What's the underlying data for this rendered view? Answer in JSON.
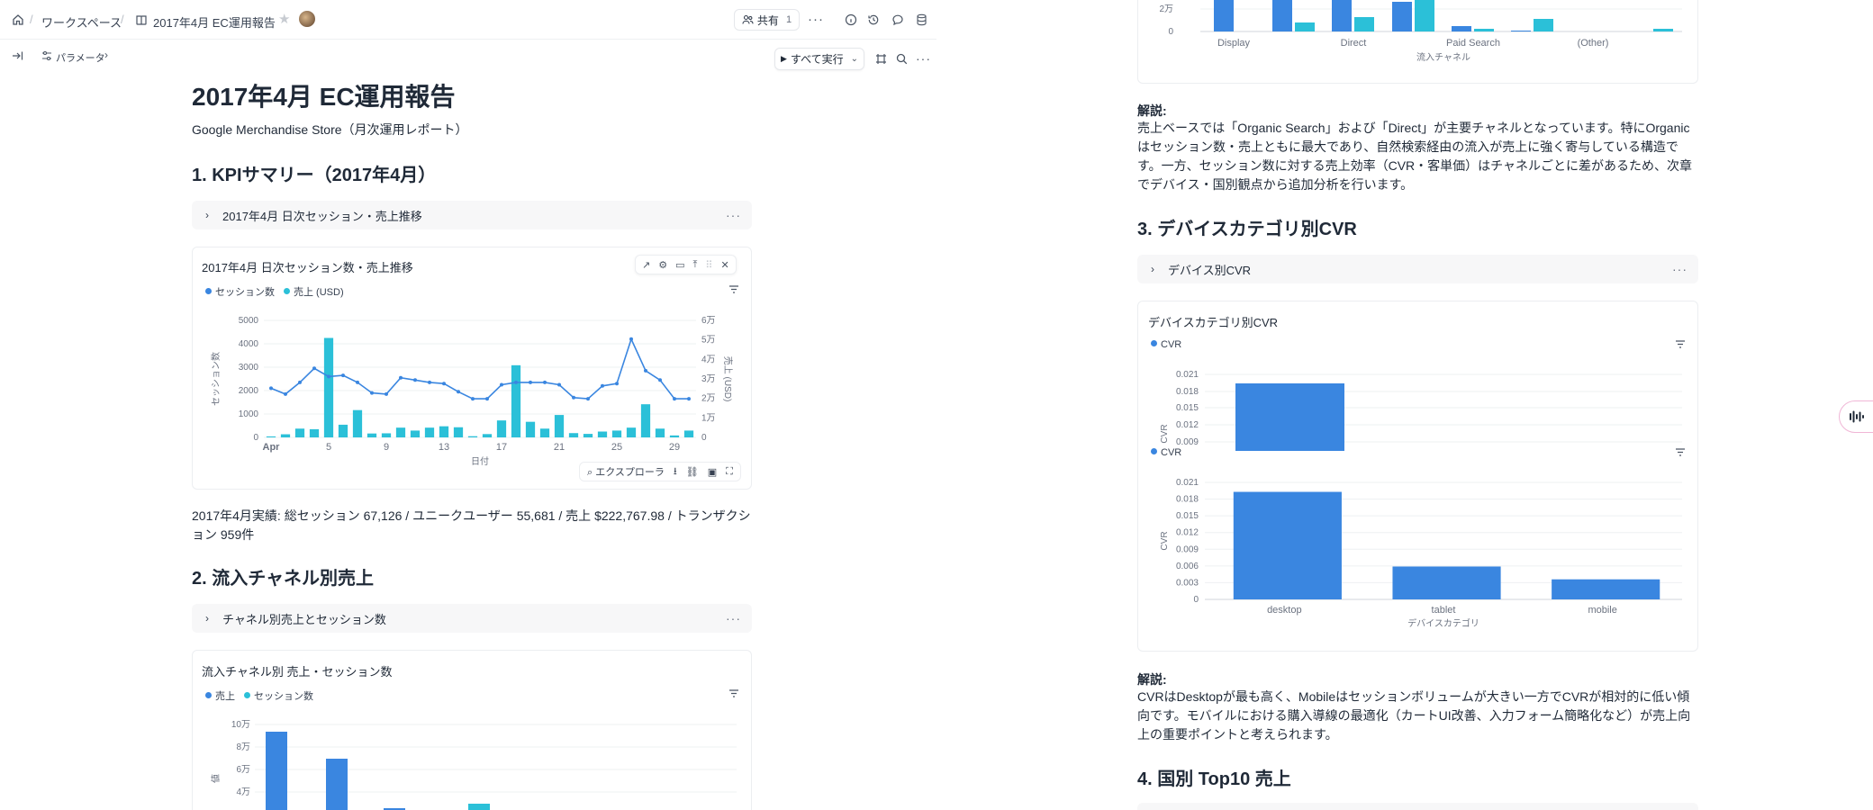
{
  "breadcrumb": {
    "home_icon": "home-icon",
    "workspace": "ワークスペース",
    "notebook": "2017年4月 EC運用報告"
  },
  "header": {
    "share_label": "共有",
    "share_count": "1"
  },
  "subbar": {
    "params_label": "パラメータ",
    "run_all_label": "すべて実行"
  },
  "doc": {
    "title": "2017年4月 EC運用報告",
    "subtitle": "Google Merchandise Store（月次運用レポート）",
    "sec1_heading": "1. KPIサマリー（2017年4月）",
    "sec1_cell_title": "2017年4月 日次セッション・売上推移",
    "sec1_summary": "2017年4月実績: 総セッション 67,126 / ユニークユーザー 55,681 / 売上 $222,767.98 / トランザクション 959件",
    "sec2_heading": "2. 流入チャネル別売上",
    "sec2_cell_title": "チャネル別売上とセッション数",
    "sec2_note_label": "解説:",
    "sec2_note": "売上ベースでは「Organic Search」および「Direct」が主要チャネルとなっています。特にOrganicはセッション数・売上ともに最大であり、自然検索経由の流入が売上に強く寄与している構造です。一方、セッション数に対する売上効率（CVR・客単価）はチャネルごとに差があるため、次章でデバイス・国別観点から追加分析を行います。",
    "sec3_heading": "3. デバイスカテゴリ別CVR",
    "sec3_cell_title": "デバイス別CVR",
    "sec3_note_label": "解説:",
    "sec3_note": "CVRはDesktopが最も高く、Mobileはセッションボリュームが大きい一方でCVRが相対的に低い傾向です。モバイルにおける購入導線の最適化（カートUI改善、入力フォーム簡略化など）が売上向上の重要ポイントと考えられます。",
    "sec4_heading": "4. 国別 Top10 売上"
  },
  "explorer_label": "エクスプローラ",
  "colors": {
    "session": "#3a86e0",
    "sales": "#2bc0d8"
  },
  "chart_data": [
    {
      "type": "bar+line",
      "title": "2017年4月 日次セッション数・売上推移",
      "legend": [
        "セッション数",
        "売上 (USD)"
      ],
      "xlabel": "日付",
      "ylabel": "セッション数",
      "y2label": "売上 (USD)",
      "x_ticks": [
        "Apr",
        "5",
        "9",
        "13",
        "17",
        "21",
        "25",
        "29"
      ],
      "y_ticks": [
        "0",
        "1000",
        "2000",
        "3000",
        "4000",
        "5000"
      ],
      "y2_ticks": [
        "0",
        "1万",
        "2万",
        "3万",
        "4万",
        "5万",
        "6万"
      ],
      "ylim": [
        0,
        5000
      ],
      "y2lim": [
        0,
        60000
      ],
      "days": [
        1,
        2,
        3,
        4,
        5,
        6,
        7,
        8,
        9,
        10,
        11,
        12,
        13,
        14,
        15,
        16,
        17,
        18,
        19,
        20,
        21,
        22,
        23,
        24,
        25,
        26,
        27,
        28,
        29,
        30
      ],
      "sessions": [
        2100,
        1850,
        2350,
        2950,
        2600,
        2650,
        2350,
        1900,
        1850,
        2550,
        2450,
        2350,
        2300,
        1950,
        1650,
        1650,
        2250,
        2350,
        2350,
        2350,
        2250,
        1700,
        1650,
        2200,
        2300,
        4200,
        2850,
        2450,
        1650,
        1650
      ],
      "sales": [
        500,
        1600,
        4500,
        4200,
        51000,
        6500,
        14000,
        2000,
        2100,
        5000,
        3500,
        5000,
        5700,
        5200,
        600,
        1700,
        8700,
        37000,
        8000,
        4500,
        11500,
        2200,
        1800,
        3000,
        3500,
        5000,
        17000,
        4500,
        1000,
        3500
      ]
    },
    {
      "type": "bar",
      "title": "流入チャネル別 売上・セッション数",
      "legend": [
        "売上",
        "セッション数"
      ],
      "xlabel": "流入チャネル",
      "ylabel": "値",
      "y_ticks": [
        "2万",
        "4万",
        "6万",
        "8万",
        "10万"
      ],
      "x_ticks": [
        "Display",
        "Direct",
        "Paid Search",
        "(Other)"
      ],
      "ylim": [
        0,
        100000
      ]
    },
    {
      "type": "bar",
      "title": "デバイスカテゴリ別CVR",
      "legend": [
        "CVR"
      ],
      "xlabel": "デバイスカテゴリ",
      "ylabel": "CVR",
      "categories": [
        "desktop",
        "tablet",
        "mobile"
      ],
      "values": [
        0.0193,
        0.0059,
        0.0036
      ],
      "y_ticks": [
        "0",
        "0.003",
        "0.006",
        "0.009",
        "0.012",
        "0.015",
        "0.018",
        "0.021"
      ],
      "preview_ticks": [
        "0.009",
        "0.012",
        "0.015",
        "0.018",
        "0.021"
      ],
      "ylim": [
        0,
        0.021
      ]
    }
  ]
}
